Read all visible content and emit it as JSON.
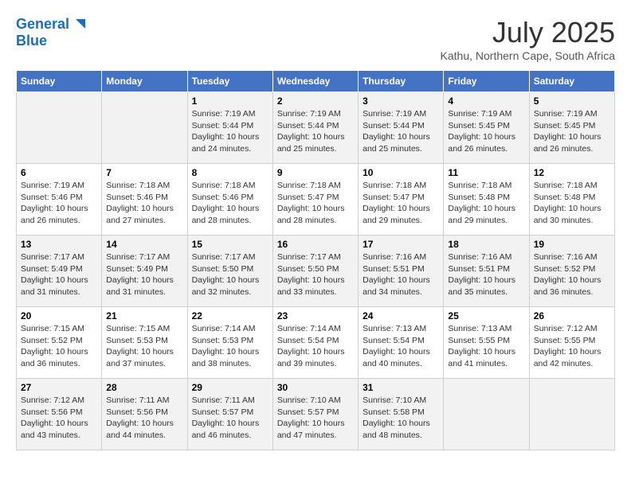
{
  "header": {
    "logo_line1": "General",
    "logo_line2": "Blue",
    "month": "July 2025",
    "location": "Kathu, Northern Cape, South Africa"
  },
  "days_of_week": [
    "Sunday",
    "Monday",
    "Tuesday",
    "Wednesday",
    "Thursday",
    "Friday",
    "Saturday"
  ],
  "weeks": [
    [
      {
        "day": "",
        "info": ""
      },
      {
        "day": "",
        "info": ""
      },
      {
        "day": "1",
        "info": "Sunrise: 7:19 AM\nSunset: 5:44 PM\nDaylight: 10 hours and 24 minutes."
      },
      {
        "day": "2",
        "info": "Sunrise: 7:19 AM\nSunset: 5:44 PM\nDaylight: 10 hours and 25 minutes."
      },
      {
        "day": "3",
        "info": "Sunrise: 7:19 AM\nSunset: 5:44 PM\nDaylight: 10 hours and 25 minutes."
      },
      {
        "day": "4",
        "info": "Sunrise: 7:19 AM\nSunset: 5:45 PM\nDaylight: 10 hours and 26 minutes."
      },
      {
        "day": "5",
        "info": "Sunrise: 7:19 AM\nSunset: 5:45 PM\nDaylight: 10 hours and 26 minutes."
      }
    ],
    [
      {
        "day": "6",
        "info": "Sunrise: 7:19 AM\nSunset: 5:46 PM\nDaylight: 10 hours and 26 minutes."
      },
      {
        "day": "7",
        "info": "Sunrise: 7:18 AM\nSunset: 5:46 PM\nDaylight: 10 hours and 27 minutes."
      },
      {
        "day": "8",
        "info": "Sunrise: 7:18 AM\nSunset: 5:46 PM\nDaylight: 10 hours and 28 minutes."
      },
      {
        "day": "9",
        "info": "Sunrise: 7:18 AM\nSunset: 5:47 PM\nDaylight: 10 hours and 28 minutes."
      },
      {
        "day": "10",
        "info": "Sunrise: 7:18 AM\nSunset: 5:47 PM\nDaylight: 10 hours and 29 minutes."
      },
      {
        "day": "11",
        "info": "Sunrise: 7:18 AM\nSunset: 5:48 PM\nDaylight: 10 hours and 29 minutes."
      },
      {
        "day": "12",
        "info": "Sunrise: 7:18 AM\nSunset: 5:48 PM\nDaylight: 10 hours and 30 minutes."
      }
    ],
    [
      {
        "day": "13",
        "info": "Sunrise: 7:17 AM\nSunset: 5:49 PM\nDaylight: 10 hours and 31 minutes."
      },
      {
        "day": "14",
        "info": "Sunrise: 7:17 AM\nSunset: 5:49 PM\nDaylight: 10 hours and 31 minutes."
      },
      {
        "day": "15",
        "info": "Sunrise: 7:17 AM\nSunset: 5:50 PM\nDaylight: 10 hours and 32 minutes."
      },
      {
        "day": "16",
        "info": "Sunrise: 7:17 AM\nSunset: 5:50 PM\nDaylight: 10 hours and 33 minutes."
      },
      {
        "day": "17",
        "info": "Sunrise: 7:16 AM\nSunset: 5:51 PM\nDaylight: 10 hours and 34 minutes."
      },
      {
        "day": "18",
        "info": "Sunrise: 7:16 AM\nSunset: 5:51 PM\nDaylight: 10 hours and 35 minutes."
      },
      {
        "day": "19",
        "info": "Sunrise: 7:16 AM\nSunset: 5:52 PM\nDaylight: 10 hours and 36 minutes."
      }
    ],
    [
      {
        "day": "20",
        "info": "Sunrise: 7:15 AM\nSunset: 5:52 PM\nDaylight: 10 hours and 36 minutes."
      },
      {
        "day": "21",
        "info": "Sunrise: 7:15 AM\nSunset: 5:53 PM\nDaylight: 10 hours and 37 minutes."
      },
      {
        "day": "22",
        "info": "Sunrise: 7:14 AM\nSunset: 5:53 PM\nDaylight: 10 hours and 38 minutes."
      },
      {
        "day": "23",
        "info": "Sunrise: 7:14 AM\nSunset: 5:54 PM\nDaylight: 10 hours and 39 minutes."
      },
      {
        "day": "24",
        "info": "Sunrise: 7:13 AM\nSunset: 5:54 PM\nDaylight: 10 hours and 40 minutes."
      },
      {
        "day": "25",
        "info": "Sunrise: 7:13 AM\nSunset: 5:55 PM\nDaylight: 10 hours and 41 minutes."
      },
      {
        "day": "26",
        "info": "Sunrise: 7:12 AM\nSunset: 5:55 PM\nDaylight: 10 hours and 42 minutes."
      }
    ],
    [
      {
        "day": "27",
        "info": "Sunrise: 7:12 AM\nSunset: 5:56 PM\nDaylight: 10 hours and 43 minutes."
      },
      {
        "day": "28",
        "info": "Sunrise: 7:11 AM\nSunset: 5:56 PM\nDaylight: 10 hours and 44 minutes."
      },
      {
        "day": "29",
        "info": "Sunrise: 7:11 AM\nSunset: 5:57 PM\nDaylight: 10 hours and 46 minutes."
      },
      {
        "day": "30",
        "info": "Sunrise: 7:10 AM\nSunset: 5:57 PM\nDaylight: 10 hours and 47 minutes."
      },
      {
        "day": "31",
        "info": "Sunrise: 7:10 AM\nSunset: 5:58 PM\nDaylight: 10 hours and 48 minutes."
      },
      {
        "day": "",
        "info": ""
      },
      {
        "day": "",
        "info": ""
      }
    ]
  ]
}
